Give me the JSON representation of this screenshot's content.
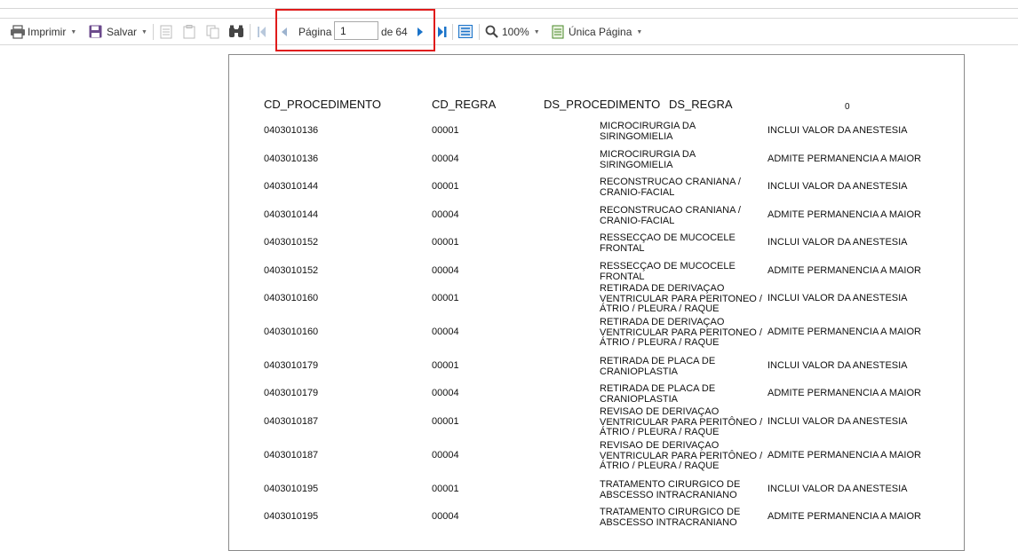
{
  "toolbar": {
    "print_label": "Imprimir",
    "save_label": "Salvar",
    "page_label": "Página",
    "page_value": "1",
    "of_label": "de",
    "total_pages": "64",
    "zoom_label": "100%",
    "view_label": "Única Página",
    "icons": [
      "printer-icon",
      "save-icon",
      "first-page-icon",
      "previous-page-icon",
      "next-page-icon",
      "last-page-icon",
      "find-icon",
      "zoom-icon",
      "page-view-icon"
    ]
  },
  "report": {
    "headers": {
      "cd_procedimento": "CD_PROCEDIMENTO",
      "cd_regra": "CD_REGRA",
      "ds_procedimento": "DS_PROCEDIMENTO",
      "ds_regra": "DS_REGRA",
      "zero": "0"
    },
    "rows": [
      {
        "cd_procedimento": "0403010136",
        "cd_regra": "00001",
        "ds_procedimento": "MICROCIRURGIA DA SIRINGOMIELIA",
        "ds_regra": "INCLUI VALOR DA ANESTESIA"
      },
      {
        "cd_procedimento": "0403010136",
        "cd_regra": "00004",
        "ds_procedimento": "MICROCIRURGIA DA SIRINGOMIELIA",
        "ds_regra": "ADMITE PERMANENCIA A MAIOR"
      },
      {
        "cd_procedimento": "0403010144",
        "cd_regra": "00001",
        "ds_procedimento": "RECONSTRUCAO CRANIANA / CRANIO-FACIAL",
        "ds_regra": "INCLUI VALOR DA ANESTESIA"
      },
      {
        "cd_procedimento": "0403010144",
        "cd_regra": "00004",
        "ds_procedimento": "RECONSTRUCAO CRANIANA / CRANIO-FACIAL",
        "ds_regra": "ADMITE PERMANENCIA A MAIOR"
      },
      {
        "cd_procedimento": "0403010152",
        "cd_regra": "00001",
        "ds_procedimento": "RESSECÇAO DE MUCOCELE FRONTAL",
        "ds_regra": "INCLUI VALOR DA ANESTESIA"
      },
      {
        "cd_procedimento": "0403010152",
        "cd_regra": "00004",
        "ds_procedimento": "RESSECÇAO DE MUCOCELE FRONTAL",
        "ds_regra": "ADMITE PERMANENCIA A MAIOR"
      },
      {
        "cd_procedimento": "0403010160",
        "cd_regra": "00001",
        "ds_procedimento": "RETIRADA DE DERIVAÇAO VENTRICULAR PARA PERITONEO / ÁTRIO / PLEURA / RAQUE",
        "ds_regra": "INCLUI VALOR DA ANESTESIA"
      },
      {
        "cd_procedimento": "0403010160",
        "cd_regra": "00004",
        "ds_procedimento": "RETIRADA DE DERIVAÇAO VENTRICULAR PARA PERITONEO / ÁTRIO / PLEURA / RAQUE",
        "ds_regra": "ADMITE PERMANENCIA A MAIOR"
      },
      {
        "cd_procedimento": "0403010179",
        "cd_regra": "00001",
        "ds_procedimento": "RETIRADA DE PLACA DE CRANIOPLASTIA",
        "ds_regra": "INCLUI VALOR DA ANESTESIA"
      },
      {
        "cd_procedimento": "0403010179",
        "cd_regra": "00004",
        "ds_procedimento": "RETIRADA DE PLACA DE CRANIOPLASTIA",
        "ds_regra": "ADMITE PERMANENCIA A MAIOR"
      },
      {
        "cd_procedimento": "0403010187",
        "cd_regra": "00001",
        "ds_procedimento": "REVISAO DE DERIVAÇAO VENTRICULAR PARA PERITÔNEO / ÁTRIO / PLEURA / RAQUE",
        "ds_regra": "INCLUI VALOR DA ANESTESIA"
      },
      {
        "cd_procedimento": "0403010187",
        "cd_regra": "00004",
        "ds_procedimento": "REVISAO DE DERIVAÇAO VENTRICULAR PARA PERITÔNEO / ÁTRIO / PLEURA / RAQUE",
        "ds_regra": "ADMITE PERMANENCIA A MAIOR"
      },
      {
        "cd_procedimento": "0403010195",
        "cd_regra": "00001",
        "ds_procedimento": "TRATAMENTO CIRURGICO DE ABSCESSO INTRACRANIANO",
        "ds_regra": "INCLUI VALOR DA ANESTESIA"
      },
      {
        "cd_procedimento": "0403010195",
        "cd_regra": "00004",
        "ds_procedimento": "TRATAMENTO CIRURGICO DE ABSCESSO INTRACRANIANO",
        "ds_regra": "ADMITE PERMANENCIA A MAIOR"
      }
    ]
  },
  "colors": {
    "highlight": "#e01b1b",
    "nav_blue": "#1a73c9"
  }
}
